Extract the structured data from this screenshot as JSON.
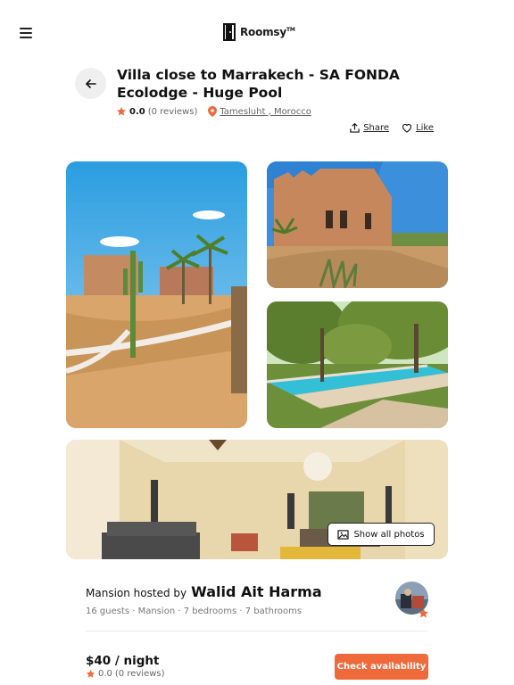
{
  "header": {
    "brand": "Roomsy",
    "tm": "TM"
  },
  "listing": {
    "title": "Villa close to Marrakech - SA FONDA Ecolodge - Huge Pool",
    "rating": "0.0",
    "reviews": "(0 reviews)",
    "location": "Tamesluht , Morocco"
  },
  "actions": {
    "share": "Share",
    "like": "Like"
  },
  "gallery": {
    "show_all": "Show all photos"
  },
  "host": {
    "prefix": "Mansion hosted by",
    "name": "Walid Ait Harma",
    "details": "16 guests · Mansion · 7 bedrooms · 7 bathrooms"
  },
  "booking": {
    "price": "$40 / night",
    "rating": "0.0",
    "reviews": "(0 reviews)",
    "cta": "Check availability"
  },
  "colors": {
    "accent": "#ee6a3a",
    "star": "#ee6a3a"
  },
  "icons": [
    "menu-icon",
    "door-logo-icon",
    "arrow-left-icon",
    "star-icon",
    "location-pin-icon",
    "share-icon",
    "heart-icon",
    "image-icon"
  ]
}
